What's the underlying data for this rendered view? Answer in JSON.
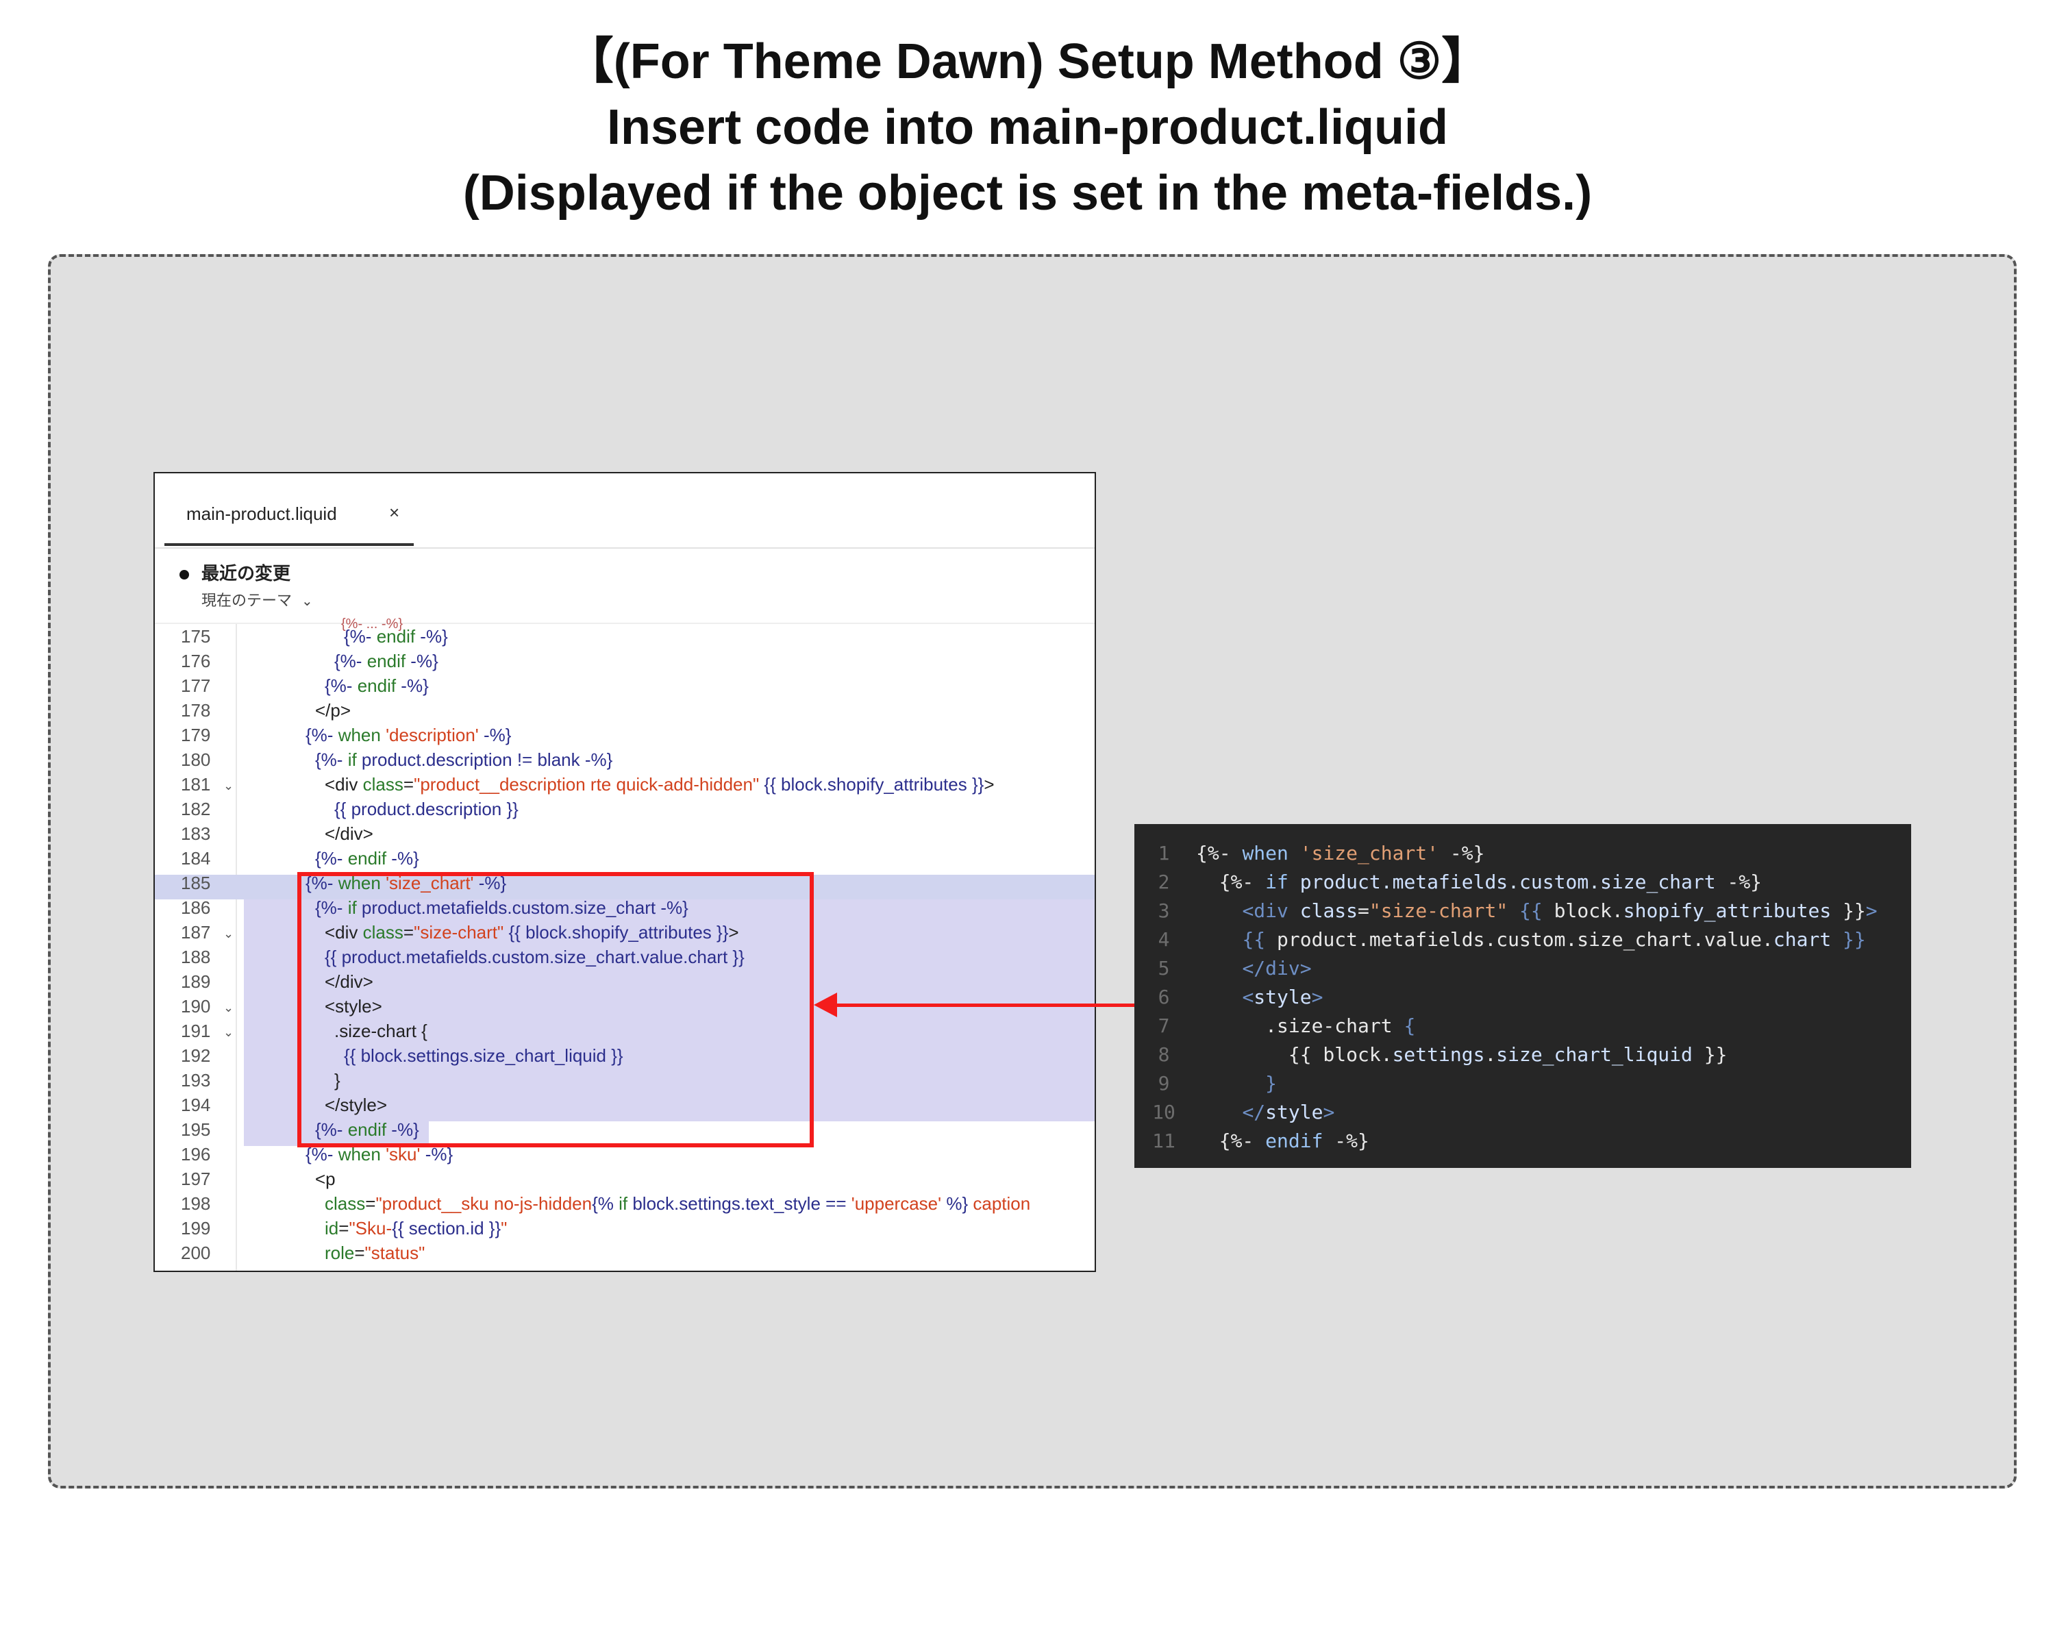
{
  "title": {
    "line1": "【(For Theme Dawn) Setup Method ③】",
    "line2": "Insert code into main-product.liquid",
    "line3": "(Displayed if the object is set in the meta-fields.)"
  },
  "editor": {
    "tab_label": "main-product.liquid",
    "tab_close": "×",
    "recent_changes": "最近の変更",
    "theme_select": "現在のテーマ",
    "line_numbers": [
      "175",
      "176",
      "177",
      "178",
      "179",
      "180",
      "181",
      "182",
      "183",
      "184",
      "185",
      "186",
      "187",
      "188",
      "189",
      "190",
      "191",
      "192",
      "193",
      "194",
      "195",
      "196",
      "197",
      "198",
      "199",
      "200"
    ]
  },
  "snippet": {
    "line_numbers": [
      "1",
      "2",
      "3",
      "4",
      "5",
      "6",
      "7",
      "8",
      "9",
      "10",
      "11"
    ]
  },
  "colors": {
    "highlight": "#d8d6f2",
    "red_annotation": "#f41c1c",
    "dark_panel": "#262626"
  }
}
